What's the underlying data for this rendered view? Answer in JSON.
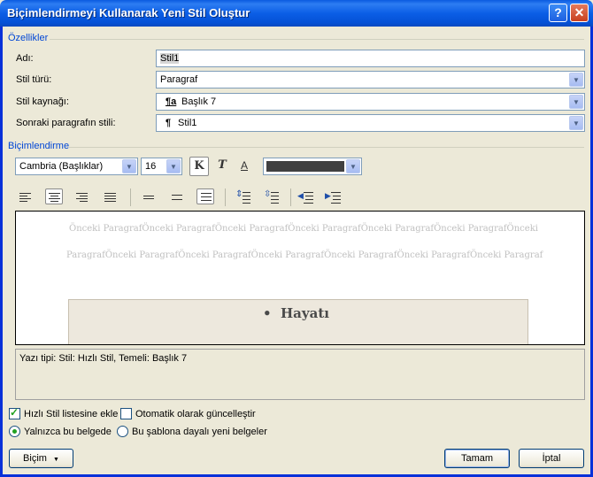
{
  "window": {
    "title": "Biçimlendirmeyi Kullanarak Yeni Stil Oluştur",
    "help": "?",
    "close": "✕"
  },
  "properties": {
    "group_label": "Özellikler",
    "name": {
      "label": "Adı:",
      "value": "Stil1"
    },
    "style_type": {
      "label": "Stil türü:",
      "value": "Paragraf"
    },
    "style_base": {
      "label": "Stil kaynağı:",
      "icon": "¶a",
      "value": "Başlık 7"
    },
    "next_style": {
      "label": "Sonraki paragrafın stili:",
      "icon": "¶",
      "value": "Stil1"
    }
  },
  "formatting": {
    "group_label": "Biçimlendirme",
    "font": "Cambria (Başlıklar)",
    "size": "16",
    "bold": "K",
    "italic": "T",
    "underline": "A",
    "color": "#404040"
  },
  "preview": {
    "prev_line1": "Önceki ParagrafÖnceki ParagrafÖnceki ParagrafÖnceki ParagrafÖnceki ParagrafÖnceki ParagrafÖnceki",
    "prev_line2": "ParagrafÖnceki ParagrafÖnceki ParagrafÖnceki ParagrafÖnceki ParagrafÖnceki ParagrafÖnceki Paragraf",
    "bullet": "•",
    "sample": "Hayatı"
  },
  "description": "Yazı tipi: Stil: Hızlı Stil, Temeli: Başlık 7",
  "options": {
    "quick_style": "Hızlı Stil listesine ekle",
    "auto_update": "Otomatik olarak güncelleştir",
    "this_doc": "Yalnızca bu belgede",
    "template_docs": "Bu şablona dayalı yeni belgeler"
  },
  "buttons": {
    "format": "Biçim",
    "ok": "Tamam",
    "cancel": "İptal"
  }
}
